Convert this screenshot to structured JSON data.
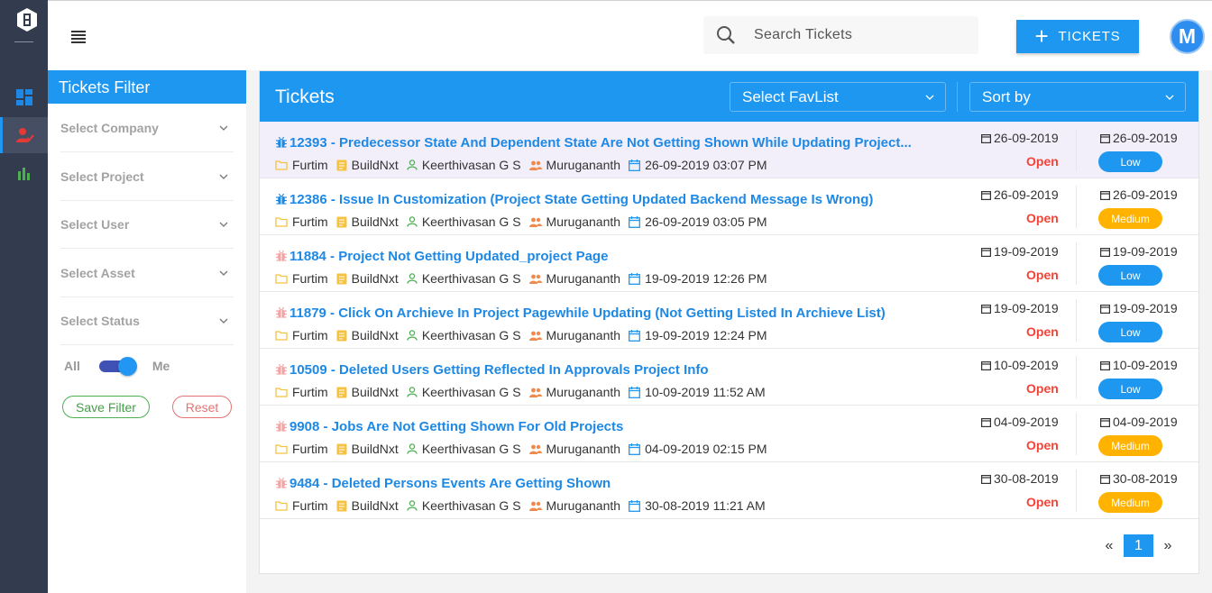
{
  "header": {
    "search_placeholder": "Search Tickets",
    "add_button_label": "TICKETS",
    "avatar_letter": "M"
  },
  "filter": {
    "title": "Tickets Filter",
    "selects": [
      "Select Company",
      "Select Project",
      "Select User",
      "Select Asset",
      "Select Status"
    ],
    "toggle_left": "All",
    "toggle_right": "Me",
    "save_label": "Save Filter",
    "reset_label": "Reset"
  },
  "tickets_panel": {
    "title": "Tickets",
    "favlist_label": "Select FavList",
    "sort_label": "Sort by"
  },
  "tickets": [
    {
      "title": "12393 - Predecessor State And Dependent State Are Not Getting Shown While Updating Project...",
      "company": "Furtim",
      "project": "BuildNxt",
      "assignee": "Keerthivasan G S",
      "reporter": "Murugananth",
      "created": "26-09-2019 03:07 PM",
      "date1": "26-09-2019",
      "date2": "26-09-2019",
      "status": "Open",
      "priority": "Low",
      "bug_color": "#1e88e5"
    },
    {
      "title": "12386 - Issue In Customization (Project State Getting Updated Backend Message Is Wrong)",
      "company": "Furtim",
      "project": "BuildNxt",
      "assignee": "Keerthivasan G S",
      "reporter": "Murugananth",
      "created": "26-09-2019 03:05 PM",
      "date1": "26-09-2019",
      "date2": "26-09-2019",
      "status": "Open",
      "priority": "Medium",
      "bug_color": "#1e88e5"
    },
    {
      "title": "11884 - Project Not Getting Updated_project Page",
      "company": "Furtim",
      "project": "BuildNxt",
      "assignee": "Keerthivasan G S",
      "reporter": "Murugananth",
      "created": "19-09-2019 12:26 PM",
      "date1": "19-09-2019",
      "date2": "19-09-2019",
      "status": "Open",
      "priority": "Low",
      "bug_color": "#f3a3a3"
    },
    {
      "title": "11879 - Click On Archieve In Project Pagewhile Updating (Not Getting Listed In Archieve List)",
      "company": "Furtim",
      "project": "BuildNxt",
      "assignee": "Keerthivasan G S",
      "reporter": "Murugananth",
      "created": "19-09-2019 12:24 PM",
      "date1": "19-09-2019",
      "date2": "19-09-2019",
      "status": "Open",
      "priority": "Low",
      "bug_color": "#f3a3a3"
    },
    {
      "title": "10509 - Deleted Users Getting Reflected In Approvals Project Info",
      "company": "Furtim",
      "project": "BuildNxt",
      "assignee": "Keerthivasan G S",
      "reporter": "Murugananth",
      "created": "10-09-2019 11:52 AM",
      "date1": "10-09-2019",
      "date2": "10-09-2019",
      "status": "Open",
      "priority": "Low",
      "bug_color": "#f3a3a3"
    },
    {
      "title": "9908 - Jobs Are Not Getting Shown For Old Projects",
      "company": "Furtim",
      "project": "BuildNxt",
      "assignee": "Keerthivasan G S",
      "reporter": "Murugananth",
      "created": "04-09-2019 02:15 PM",
      "date1": "04-09-2019",
      "date2": "04-09-2019",
      "status": "Open",
      "priority": "Medium",
      "bug_color": "#f3a3a3"
    },
    {
      "title": "9484 - Deleted Persons Events Are Getting Shown",
      "company": "Furtim",
      "project": "BuildNxt",
      "assignee": "Keerthivasan G S",
      "reporter": "Murugananth",
      "created": "30-08-2019 11:21 AM",
      "date1": "30-08-2019",
      "date2": "30-08-2019",
      "status": "Open",
      "priority": "Medium",
      "bug_color": "#f3a3a3"
    }
  ],
  "priority_colors": {
    "Low": "#1e97f0",
    "Medium": "#ffb300"
  },
  "pagination": {
    "prev": "«",
    "current": "1",
    "next": "»"
  }
}
